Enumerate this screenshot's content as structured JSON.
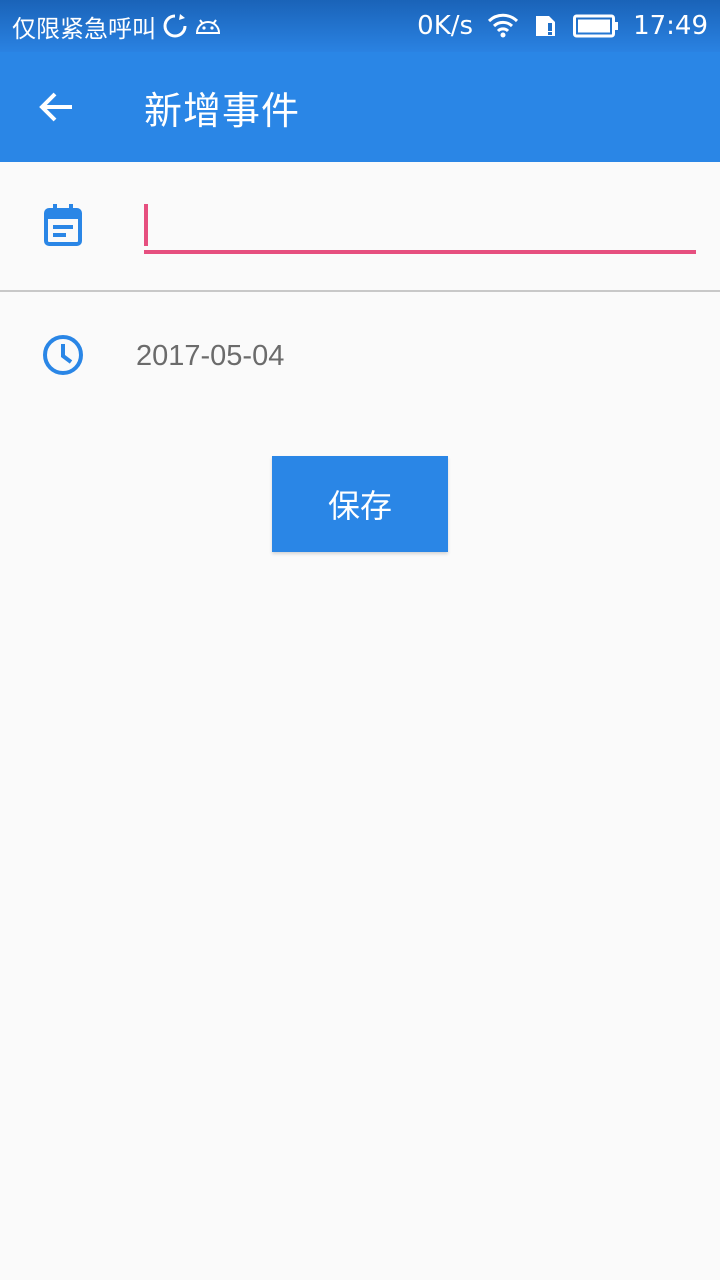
{
  "status_bar": {
    "carrier": "仅限紧急呼叫",
    "net_speed": "0K/s",
    "time": "17:49"
  },
  "app_bar": {
    "title": "新增事件"
  },
  "form": {
    "title_value": "",
    "title_placeholder": "",
    "date": "2017-05-04",
    "save_label": "保存"
  },
  "colors": {
    "primary": "#2a86e6",
    "accent": "#e64f7f"
  },
  "icons": [
    "sync-icon",
    "android-debug-icon",
    "wifi-icon",
    "sim-icon",
    "battery-icon",
    "back-arrow-icon",
    "calendar-icon",
    "clock-icon"
  ]
}
